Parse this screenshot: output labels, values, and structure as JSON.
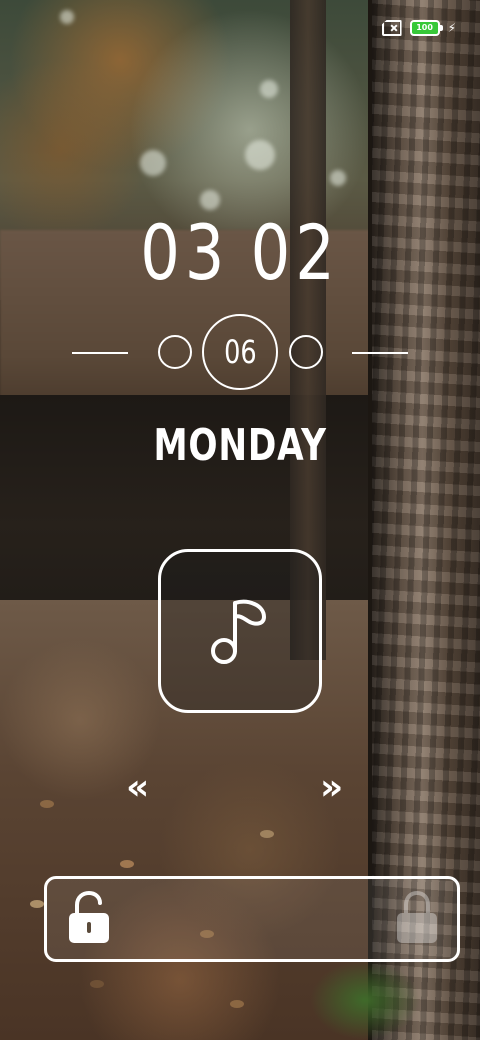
{
  "status_bar": {
    "sim_icon": "no-sim-icon",
    "battery_level": "100",
    "battery_color": "#37c838",
    "charging_icon": "lightning-bolt-icon"
  },
  "clock": {
    "hours": "03",
    "minutes": "02"
  },
  "date": {
    "day": "06",
    "weekday": "MONDAY"
  },
  "music_widget": {
    "icon": "music-note-icon"
  },
  "swipe_hints": {
    "left_icon": "double-chevron-left-icon",
    "right_icon": "double-chevron-right-icon",
    "left_glyph": "«",
    "right_glyph": "»"
  },
  "unlock_slider": {
    "handle_icon": "unlocked-padlock-icon",
    "target_icon": "locked-padlock-icon"
  }
}
